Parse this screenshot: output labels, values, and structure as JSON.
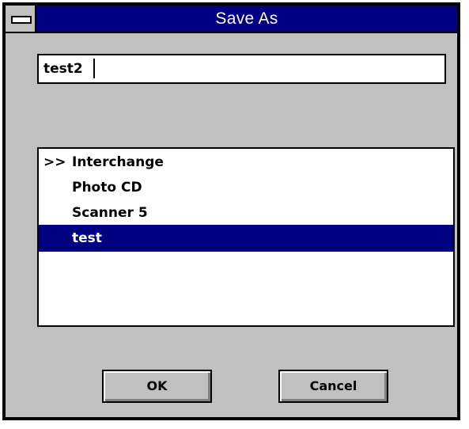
{
  "window": {
    "title": "Save As"
  },
  "filename": {
    "value": "test2"
  },
  "list": {
    "items": [
      {
        "marker": ">>",
        "label": "Interchange",
        "selected": false
      },
      {
        "marker": "",
        "label": "Photo CD",
        "selected": false
      },
      {
        "marker": "",
        "label": "Scanner 5",
        "selected": false
      },
      {
        "marker": "",
        "label": "test",
        "selected": true
      }
    ]
  },
  "buttons": {
    "ok_label": "OK",
    "cancel_label": "Cancel"
  },
  "colors": {
    "titlebar": "#000080",
    "face": "#c0c0c0",
    "selection": "#000080",
    "selection_text": "#ffffff"
  },
  "icons": {
    "system_menu": "system-menu-icon"
  }
}
